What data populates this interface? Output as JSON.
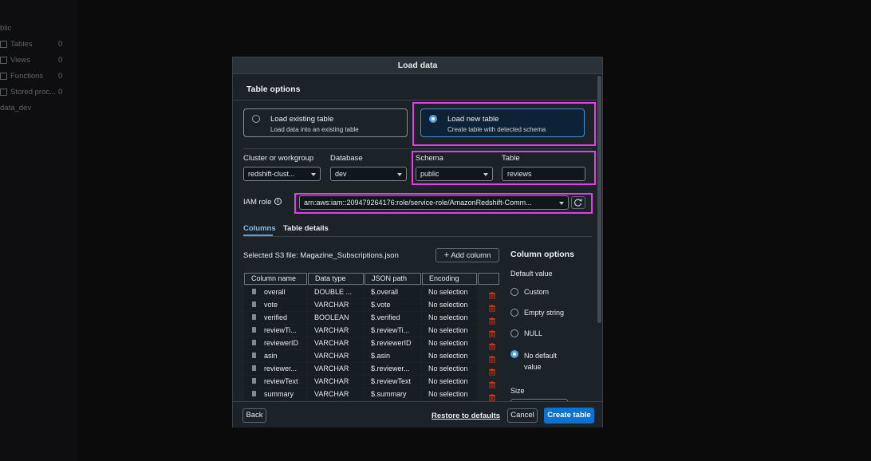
{
  "sidebar": {
    "items": [
      {
        "label": "blic",
        "count": ""
      },
      {
        "label": "Tables",
        "count": "0"
      },
      {
        "label": "Views",
        "count": "0"
      },
      {
        "label": "Functions",
        "count": "0"
      },
      {
        "label": "Stored proc...",
        "count": "0"
      },
      {
        "label": "data_dev",
        "count": ""
      }
    ]
  },
  "modal": {
    "title": "Load data",
    "section_title": "Table options",
    "options": {
      "existing": {
        "title": "Load existing table",
        "desc": "Load data into an existing table"
      },
      "new": {
        "title": "Load new table",
        "desc": "Create table with detected schema",
        "selected": true
      }
    },
    "fields": {
      "cluster": {
        "label": "Cluster or workgroup",
        "value": "redshift-clust..."
      },
      "database": {
        "label": "Database",
        "value": "dev"
      },
      "schema": {
        "label": "Schema",
        "value": "public"
      },
      "table": {
        "label": "Table",
        "value": "reviews"
      },
      "iam": {
        "label": "IAM role",
        "value": "arn:aws:iam::209479264176:role/service-role/AmazonRedshift-Comm..."
      }
    },
    "tabs": [
      {
        "label": "Columns",
        "active": true
      },
      {
        "label": "Table details",
        "active": false
      }
    ],
    "s3_file_label": "Selected S3 file: Magazine_Subscriptions.json",
    "add_column": "Add column",
    "table_headers": [
      "Column name",
      "Data type",
      "JSON path",
      "Encoding"
    ],
    "rows": [
      {
        "name": "overall",
        "type": "DOUBLE ...",
        "path": "$.overall",
        "encoding": "No selection"
      },
      {
        "name": "vote",
        "type": "VARCHAR",
        "path": "$.vote",
        "encoding": "No selection"
      },
      {
        "name": "verified",
        "type": "BOOLEAN",
        "path": "$.verified",
        "encoding": "No selection"
      },
      {
        "name": "reviewTi...",
        "type": "VARCHAR",
        "path": "$.reviewTi...",
        "encoding": "No selection"
      },
      {
        "name": "reviewerID",
        "type": "VARCHAR",
        "path": "$.reviewerID",
        "encoding": "No selection"
      },
      {
        "name": "asin",
        "type": "VARCHAR",
        "path": "$.asin",
        "encoding": "No selection"
      },
      {
        "name": "reviewer...",
        "type": "VARCHAR",
        "path": "$.reviewer...",
        "encoding": "No selection"
      },
      {
        "name": "reviewText",
        "type": "VARCHAR",
        "path": "$.reviewText",
        "encoding": "No selection"
      },
      {
        "name": "summary",
        "type": "VARCHAR",
        "path": "$.summary",
        "encoding": "No selection"
      }
    ],
    "column_options": {
      "title": "Column options",
      "default_value_label": "Default value",
      "choices": [
        "Custom",
        "Empty string",
        "NULL",
        "No default value"
      ],
      "selected": "No default value",
      "size_label": "Size"
    },
    "footer": {
      "back": "Back",
      "restore": "Restore to defaults",
      "cancel": "Cancel",
      "create": "Create table"
    }
  },
  "colors": {
    "accent": "#0972d3",
    "highlight": "#e83bea",
    "danger": "#d13212"
  }
}
